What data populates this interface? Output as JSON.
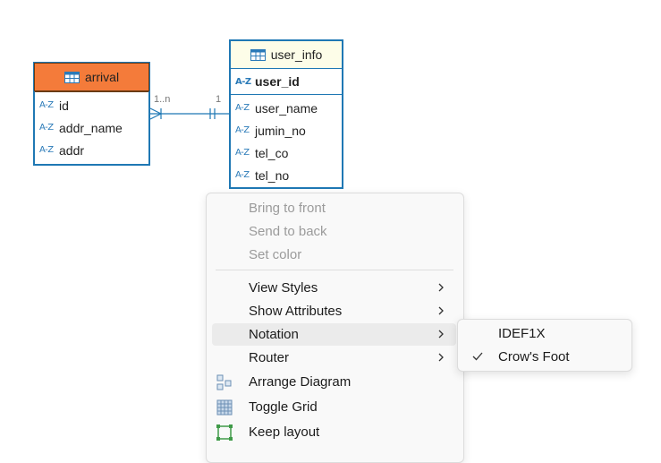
{
  "entities": {
    "arrival": {
      "name": "arrival",
      "attributes": [
        "id",
        "addr_name",
        "addr"
      ],
      "header_color": "#f47b3a"
    },
    "user_info": {
      "name": "user_info",
      "primary_key": "user_id",
      "attributes": [
        "user_name",
        "jumin_no",
        "tel_co",
        "tel_no"
      ],
      "header_color": "#fdfde8"
    },
    "type_badge": "A-Z"
  },
  "relationship": {
    "from_cardinality": "1..n",
    "to_cardinality": "1"
  },
  "context_menu": {
    "items": [
      {
        "label": "Bring to front",
        "enabled": false
      },
      {
        "label": "Send to back",
        "enabled": false
      },
      {
        "label": "Set color",
        "enabled": false
      },
      {
        "label": "View Styles",
        "enabled": true,
        "submenu": true
      },
      {
        "label": "Show Attributes",
        "enabled": true,
        "submenu": true
      },
      {
        "label": "Notation",
        "enabled": true,
        "submenu": true,
        "highlighted": true
      },
      {
        "label": "Router",
        "enabled": true,
        "submenu": true
      },
      {
        "label": "Arrange Diagram",
        "enabled": true,
        "icon": "arrange-diagram-icon"
      },
      {
        "label": "Toggle Grid",
        "enabled": true,
        "icon": "grid-icon"
      },
      {
        "label": "Keep layout",
        "enabled": true,
        "icon": "keep-layout-icon"
      }
    ]
  },
  "notation_submenu": {
    "items": [
      {
        "label": "IDEF1X",
        "checked": false
      },
      {
        "label": "Crow's Foot",
        "checked": true
      }
    ]
  }
}
